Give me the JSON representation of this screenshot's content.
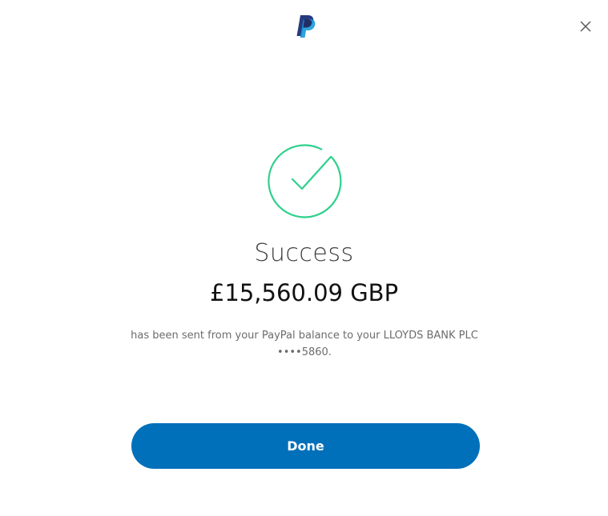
{
  "brand": {
    "logo_icon": "paypal-logo",
    "dark_blue": "#253b80",
    "light_blue": "#179bd7"
  },
  "header": {
    "close_icon": "close-icon"
  },
  "status": {
    "icon": "check-circle-icon",
    "accent_color": "#2fd08d",
    "title": "Success"
  },
  "transfer": {
    "amount": "£15,560.09 GBP",
    "message_line1": "has been sent from your PayPal balance to your LLOYDS BANK PLC",
    "message_line2": "••••5860."
  },
  "actions": {
    "done_label": "Done",
    "done_color": "#0070ba"
  }
}
